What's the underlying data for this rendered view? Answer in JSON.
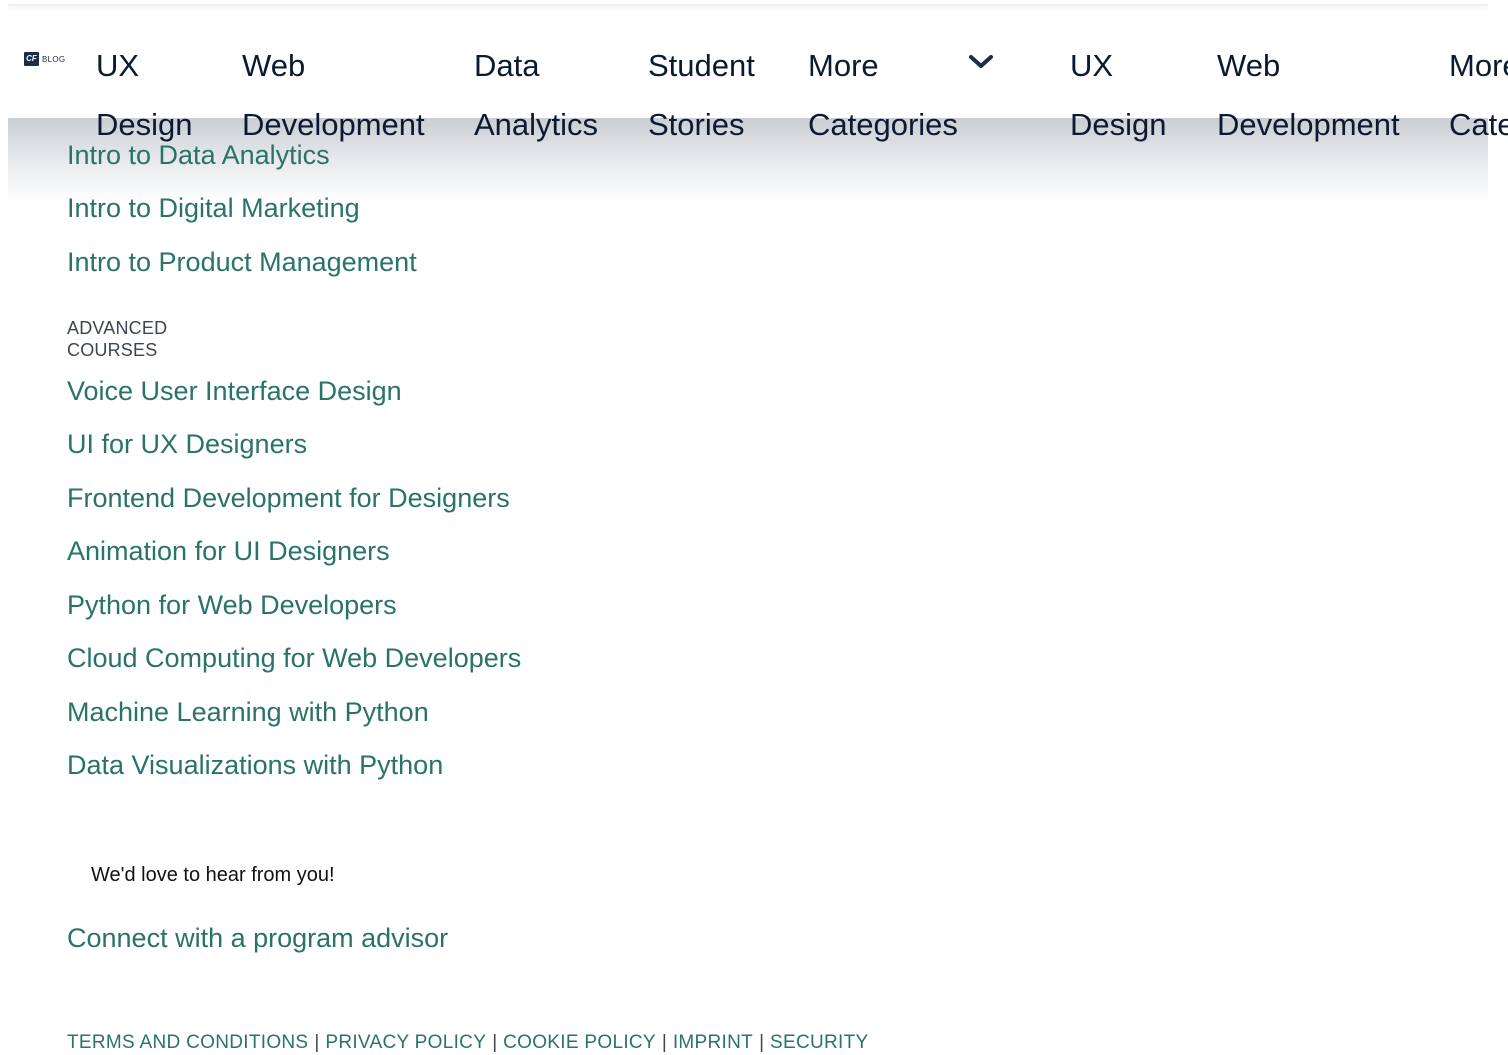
{
  "logo": {
    "mark": "CF",
    "label": "BLOG"
  },
  "nav": {
    "items": [
      {
        "line1": "UX",
        "line2": "Design"
      },
      {
        "line1": "Web",
        "line2": "Development"
      },
      {
        "line1": "Data",
        "line2": "Analytics"
      },
      {
        "line1": "Student",
        "line2": "Stories"
      },
      {
        "line1": "More",
        "line2": "Categories"
      }
    ],
    "duplicate_items": [
      {
        "line1": "UX",
        "line2": "Design"
      },
      {
        "line1": "Web",
        "line2": "Development"
      },
      {
        "line1": "More",
        "line2": "Categories"
      }
    ]
  },
  "intro_courses": [
    "Intro to Data Analytics",
    "Intro to Digital Marketing",
    "Intro to Product Management"
  ],
  "advanced": {
    "heading": "ADVANCED COURSES",
    "courses": [
      "Voice User Interface Design",
      "UI for UX Designers",
      "Frontend Development for Designers",
      "Animation for UI Designers",
      "Python for Web Developers",
      "Cloud Computing for Web Developers",
      "Machine Learning with Python",
      "Data Visualizations with Python"
    ]
  },
  "contact": {
    "prompt": "We'd love to hear from you!",
    "link": "Connect with a program advisor"
  },
  "footer": {
    "links": [
      "TERMS AND CONDITIONS",
      "PRIVACY POLICY",
      "COOKIE POLICY",
      "IMPRINT",
      "SECURITY"
    ],
    "separator": "|"
  },
  "colors": {
    "link": "#2a7368",
    "nav_text": "#0b1a30",
    "brand": "#1b2d4a"
  }
}
